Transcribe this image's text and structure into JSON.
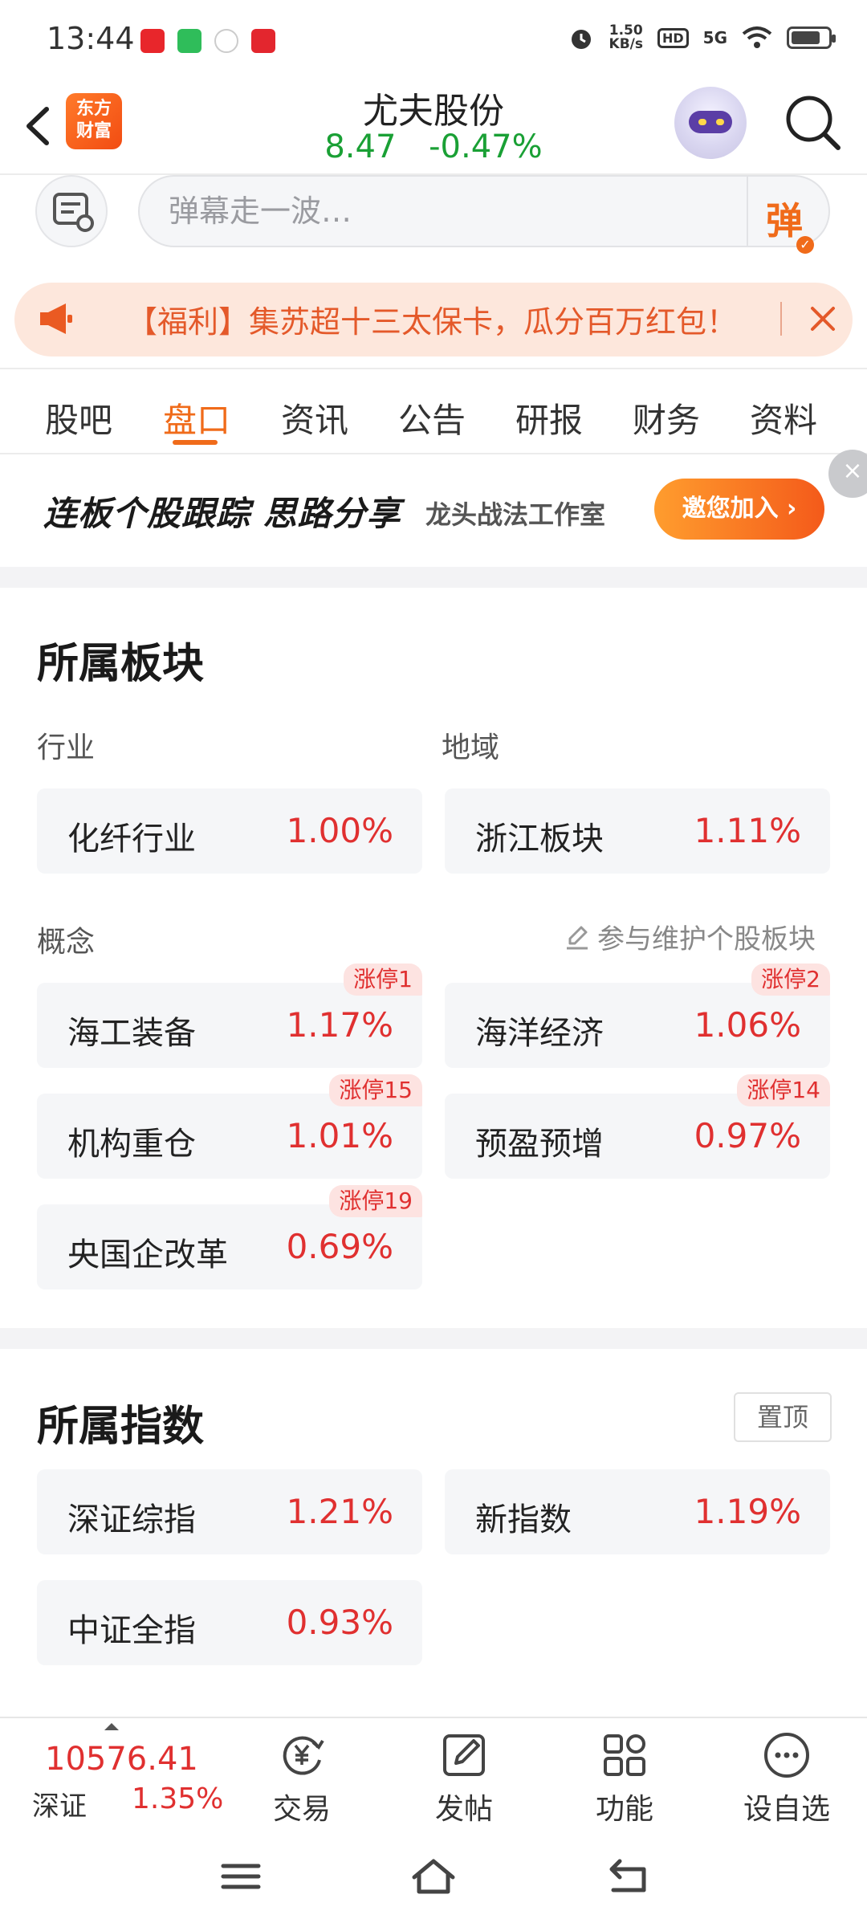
{
  "status_bar": {
    "time": "13:44",
    "net_speed_value": "1.50",
    "net_speed_unit": "KB/s",
    "hd": "HD",
    "signal": "5G",
    "battery_level": 0.8
  },
  "header": {
    "brand_logo": "东方\n财富",
    "brand_logo_line1": "东方",
    "brand_logo_line2": "财富",
    "stock_name": "尤夫股份",
    "price": "8.47",
    "change_pct": "-0.47%",
    "price_color": "#1aa035"
  },
  "danmu": {
    "placeholder": "弹幕走一波…",
    "send_label": "弹"
  },
  "promo": {
    "text": "【福利】集苏超十三太保卡，瓜分百万红包！"
  },
  "tabs": [
    {
      "label": "股吧",
      "active": false
    },
    {
      "label": "盘口",
      "active": true
    },
    {
      "label": "资讯",
      "active": false
    },
    {
      "label": "公告",
      "active": false
    },
    {
      "label": "研报",
      "active": false
    },
    {
      "label": "财务",
      "active": false
    },
    {
      "label": "资料",
      "active": false
    }
  ],
  "ad": {
    "title": "连板个股跟踪 思路分享",
    "subtitle": "龙头战法工作室",
    "join_label": "邀您加入 ›"
  },
  "sectors": {
    "title": "所属板块",
    "industry_label": "行业",
    "region_label": "地域",
    "industry": {
      "name": "化纤行业",
      "pct": "1.00%"
    },
    "region": {
      "name": "浙江板块",
      "pct": "1.11%"
    },
    "concept_label": "概念",
    "maintain_link": "参与维护个股板块",
    "concepts": [
      {
        "name": "海工装备",
        "pct": "1.17%",
        "badge": "涨停1"
      },
      {
        "name": "海洋经济",
        "pct": "1.06%",
        "badge": "涨停2"
      },
      {
        "name": "机构重仓",
        "pct": "1.01%",
        "badge": "涨停15"
      },
      {
        "name": "预盈预增",
        "pct": "0.97%",
        "badge": "涨停14"
      },
      {
        "name": "央国企改革",
        "pct": "0.69%",
        "badge": "涨停19"
      }
    ]
  },
  "indices": {
    "title": "所属指数",
    "pin_label": "置顶",
    "items": [
      {
        "name": "深证综指",
        "pct": "1.21%"
      },
      {
        "name": "新指数",
        "pct": "1.19%"
      },
      {
        "name": "中证全指",
        "pct": "0.93%"
      }
    ]
  },
  "bottom_bar": {
    "index_value": "10576.41",
    "index_name": "深证",
    "index_pct": "1.35%",
    "items": [
      {
        "label": "交易",
        "icon": "trade-yen-icon"
      },
      {
        "label": "发帖",
        "icon": "edit-post-icon"
      },
      {
        "label": "功能",
        "icon": "grid-functions-icon"
      },
      {
        "label": "设自选",
        "icon": "more-dots-icon"
      }
    ]
  },
  "colors": {
    "accent": "#f06b1a",
    "up_red": "#e03030",
    "down_green": "#1aa035"
  }
}
